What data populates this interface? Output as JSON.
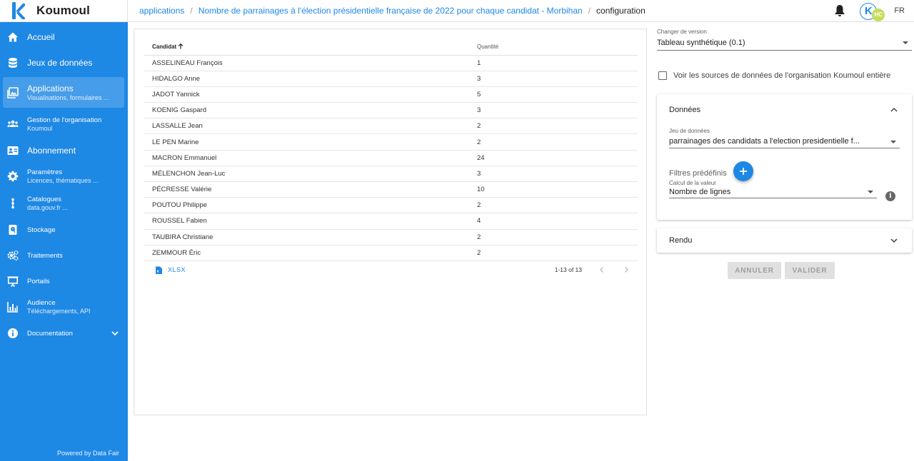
{
  "brand": {
    "name": "Koumoul",
    "logo_letter": "K"
  },
  "breadcrumbs": [
    {
      "label": "applications"
    },
    {
      "label": "Nombre de parrainages à l'élection présidentielle française de 2022 pour chaque candidat - Morbihan"
    },
    {
      "label": "configuration"
    }
  ],
  "topbar": {
    "avatar_letter": "K",
    "avatar_initials": "HC",
    "lang": "FR"
  },
  "sidebar": {
    "items": [
      {
        "label": "Accueil",
        "icon": "home-icon"
      },
      {
        "label": "Jeux de données",
        "icon": "database-icon"
      },
      {
        "label": "Applications",
        "sub": "Visualisations, formulaires ...",
        "icon": "image-icon"
      },
      {
        "label": "Gestion de l'organisation",
        "sub": "Koumoul",
        "icon": "group-icon"
      },
      {
        "label": "Abonnement",
        "icon": "card-icon"
      },
      {
        "label": "Paramètres",
        "sub": "Licences, thématiques ...",
        "icon": "gear-icon"
      },
      {
        "label": "Catalogues",
        "sub": "data.gouv.fr ...",
        "icon": "network-icon"
      },
      {
        "label": "Stockage",
        "icon": "storage-icon"
      },
      {
        "label": "Traitements",
        "icon": "cogs-icon"
      },
      {
        "label": "Portails",
        "icon": "presentation-icon"
      },
      {
        "label": "Audience",
        "sub": "Téléchargements, API",
        "icon": "bar-chart-icon"
      },
      {
        "label": "Documentation",
        "icon": "info-icon"
      }
    ],
    "powered_by": "Powered by Data Fair"
  },
  "table": {
    "headers": {
      "candidat": "Candidat",
      "quantite": "Quantité"
    },
    "rows": [
      {
        "candidat": "ASSELINEAU François",
        "quantite": "1"
      },
      {
        "candidat": "HIDALGO Anne",
        "quantite": "3"
      },
      {
        "candidat": "JADOT Yannick",
        "quantite": "5"
      },
      {
        "candidat": "KOENIG Gaspard",
        "quantite": "3"
      },
      {
        "candidat": "LASSALLE Jean",
        "quantite": "2"
      },
      {
        "candidat": "LE PEN Marine",
        "quantite": "2"
      },
      {
        "candidat": "MACRON Emmanuel",
        "quantite": "24"
      },
      {
        "candidat": "MÉLENCHON Jean-Luc",
        "quantite": "3"
      },
      {
        "candidat": "PÉCRESSE Valérie",
        "quantite": "10"
      },
      {
        "candidat": "POUTOU Philippe",
        "quantite": "2"
      },
      {
        "candidat": "ROUSSEL Fabien",
        "quantite": "4"
      },
      {
        "candidat": "TAUBIRA Christiane",
        "quantite": "2"
      },
      {
        "candidat": "ZEMMOUR Éric",
        "quantite": "2"
      }
    ],
    "export_label": "XLSX",
    "pagination": "1-13 of 13"
  },
  "config": {
    "version_label": "Changer de version",
    "version_value": "Tableau synthétique (0.1)",
    "checkbox_label": "Voir les sources de données de l'organisation Koumoul entière",
    "donnees_title": "Données",
    "dataset_label": "Jeu de données",
    "dataset_value": "parrainages des candidats a l'election presidentielle f...",
    "filters_label": "Filtres prédéfinis",
    "calc_label": "Calcul de la valeur",
    "calc_value": "Nombre de lignes",
    "rendu_title": "Rendu",
    "cancel_label": "ANNULER",
    "validate_label": "VALIDER"
  },
  "colors": {
    "primary": "#1e88e5",
    "avatar_badge": "#c6dc5b"
  }
}
